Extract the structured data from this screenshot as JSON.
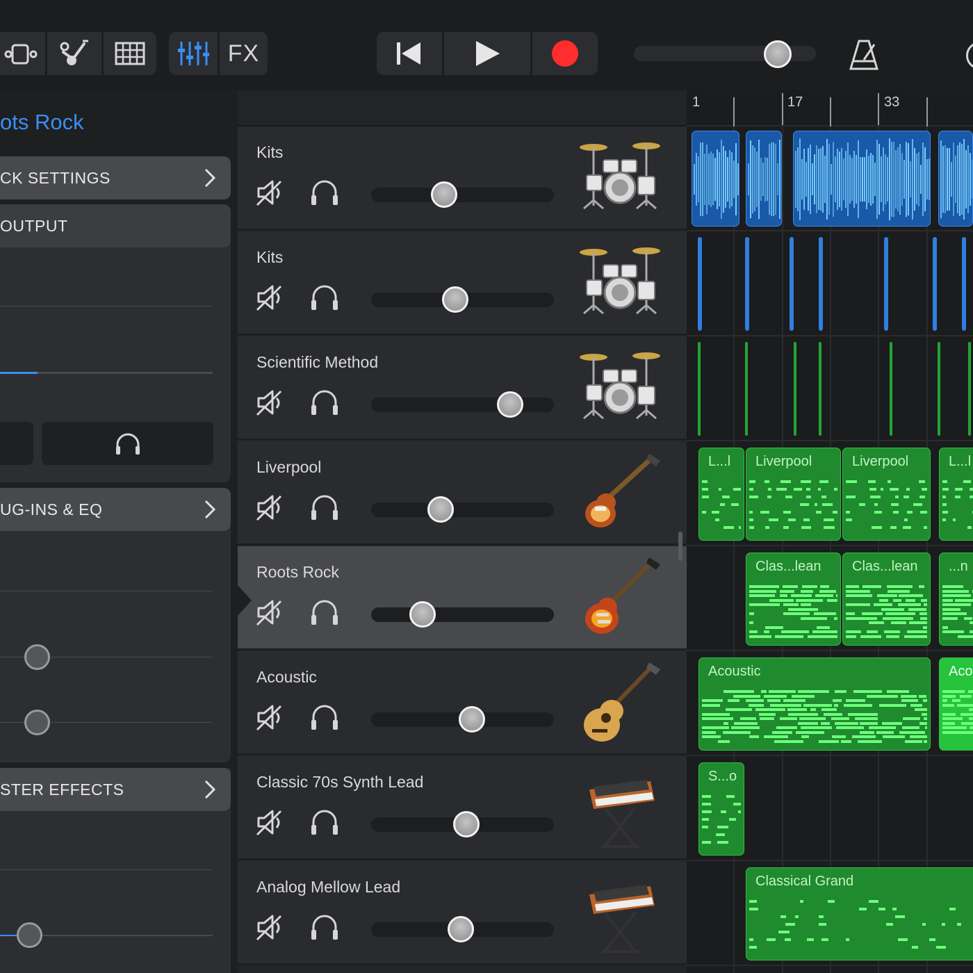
{
  "toolbar": {
    "fx_label": "FX",
    "icons": [
      "view-toggle-icon",
      "browser-icon",
      "grid-icon",
      "mixer-icon",
      "fx-button",
      "rewind-icon",
      "play-icon",
      "record-icon",
      "metronome-icon"
    ],
    "master_volume": 0.78,
    "record_color": "#ff2d2d",
    "accent": "#3a8ef5"
  },
  "inspector": {
    "title": "ots Rock",
    "sections": [
      {
        "label": "CK SETTINGS"
      },
      {
        "label": " OUTPUT"
      },
      {
        "label": "UG-INS & EQ"
      },
      {
        "label": "STER EFFECTS"
      }
    ]
  },
  "ruler": {
    "markers": [
      "1",
      "17",
      "33"
    ]
  },
  "tracks": [
    {
      "name": "Kits",
      "volume": 0.4,
      "instrument": "drum-kit-icon"
    },
    {
      "name": "Kits",
      "volume": 0.46,
      "instrument": "drum-kit-icon"
    },
    {
      "name": "Scientific Method",
      "volume": 0.76,
      "instrument": "drum-kit-icon"
    },
    {
      "name": "Liverpool",
      "volume": 0.38,
      "instrument": "bass-guitar-icon"
    },
    {
      "name": "Roots Rock",
      "volume": 0.28,
      "instrument": "electric-guitar-icon"
    },
    {
      "name": "Acoustic",
      "volume": 0.55,
      "instrument": "acoustic-guitar-icon"
    },
    {
      "name": "Classic 70s Synth Lead",
      "volume": 0.52,
      "instrument": "synth-icon"
    },
    {
      "name": "Analog Mellow Lead",
      "volume": 0.49,
      "instrument": "synth-icon"
    }
  ],
  "regions": {
    "liverpool": [
      "L...l",
      "Liverpool",
      "Liverpool",
      "L...l"
    ],
    "roots_rock": [
      "Clas...lean",
      "Clas...lean",
      "...n"
    ],
    "acoustic": [
      "Acoustic",
      "Aco"
    ],
    "synth": [
      "S...o"
    ],
    "mellow": [
      "Classical Grand"
    ]
  },
  "colors": {
    "audio_region": "#1a58a8",
    "midi_region": "#1f8a2e",
    "selected_track": "#48494c"
  }
}
